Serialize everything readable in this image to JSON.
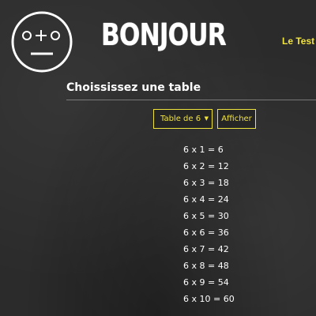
{
  "header": {
    "brand": "BONJOUR",
    "nav_link": "Le Test",
    "logo_icon": "smiley-face-icon"
  },
  "main": {
    "heading": "Choississez une table",
    "table_select": {
      "selected": "Table de 6"
    },
    "show_button": "Afficher",
    "results": [
      "6 x 1 = 6",
      "6 x 2 = 12",
      "6 x 3 = 18",
      "6 x 4 = 24",
      "6 x 5 = 30",
      "6 x 6 = 36",
      "6 x 7 = 42",
      "6 x 8 = 48",
      "6 x 9 = 54",
      "6 x 10 = 60"
    ]
  },
  "colors": {
    "accent": "#f1e33d",
    "background": "#2b2b2b",
    "text": "#ffffff"
  }
}
